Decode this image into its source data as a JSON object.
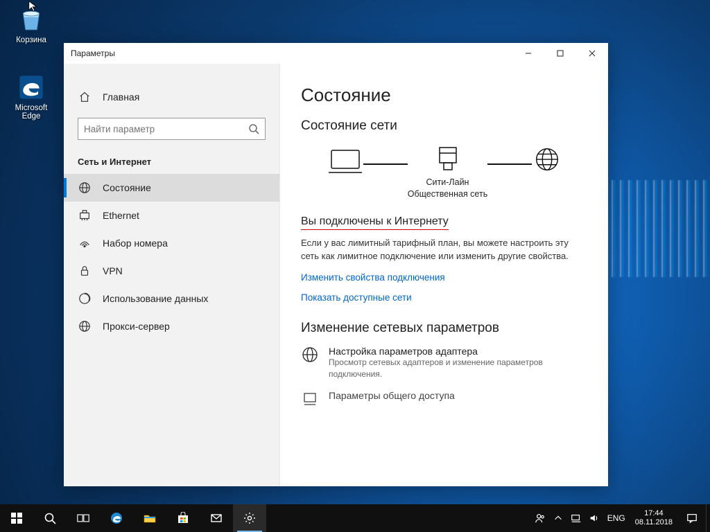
{
  "desktop": {
    "recycle_label": "Корзина",
    "edge_label": "Microsoft Edge"
  },
  "window": {
    "title": "Параметры"
  },
  "sidebar": {
    "home": "Главная",
    "search_placeholder": "Найти параметр",
    "group": "Сеть и Интернет",
    "items": [
      {
        "label": "Состояние"
      },
      {
        "label": "Ethernet"
      },
      {
        "label": "Набор номера"
      },
      {
        "label": "VPN"
      },
      {
        "label": "Использование данных"
      },
      {
        "label": "Прокси-сервер"
      }
    ]
  },
  "main": {
    "title": "Состояние",
    "net_status_heading": "Состояние сети",
    "net_name": "Сити-Лайн",
    "net_type": "Общественная сеть",
    "connected_heading": "Вы подключены к Интернету",
    "connected_body": "Если у вас лимитный тарифный план, вы можете настроить эту сеть как лимитное подключение или изменить другие свойства.",
    "link_change_props": "Изменить свойства подключения",
    "link_show_nets": "Показать доступные сети",
    "change_settings_heading": "Изменение сетевых параметров",
    "adapter_title": "Настройка параметров адаптера",
    "adapter_sub": "Просмотр сетевых адаптеров и изменение параметров подключения.",
    "sharing_title": "Параметры общего доступа"
  },
  "taskbar": {
    "lang": "ENG",
    "time": "17:44",
    "date": "08.11.2018"
  }
}
